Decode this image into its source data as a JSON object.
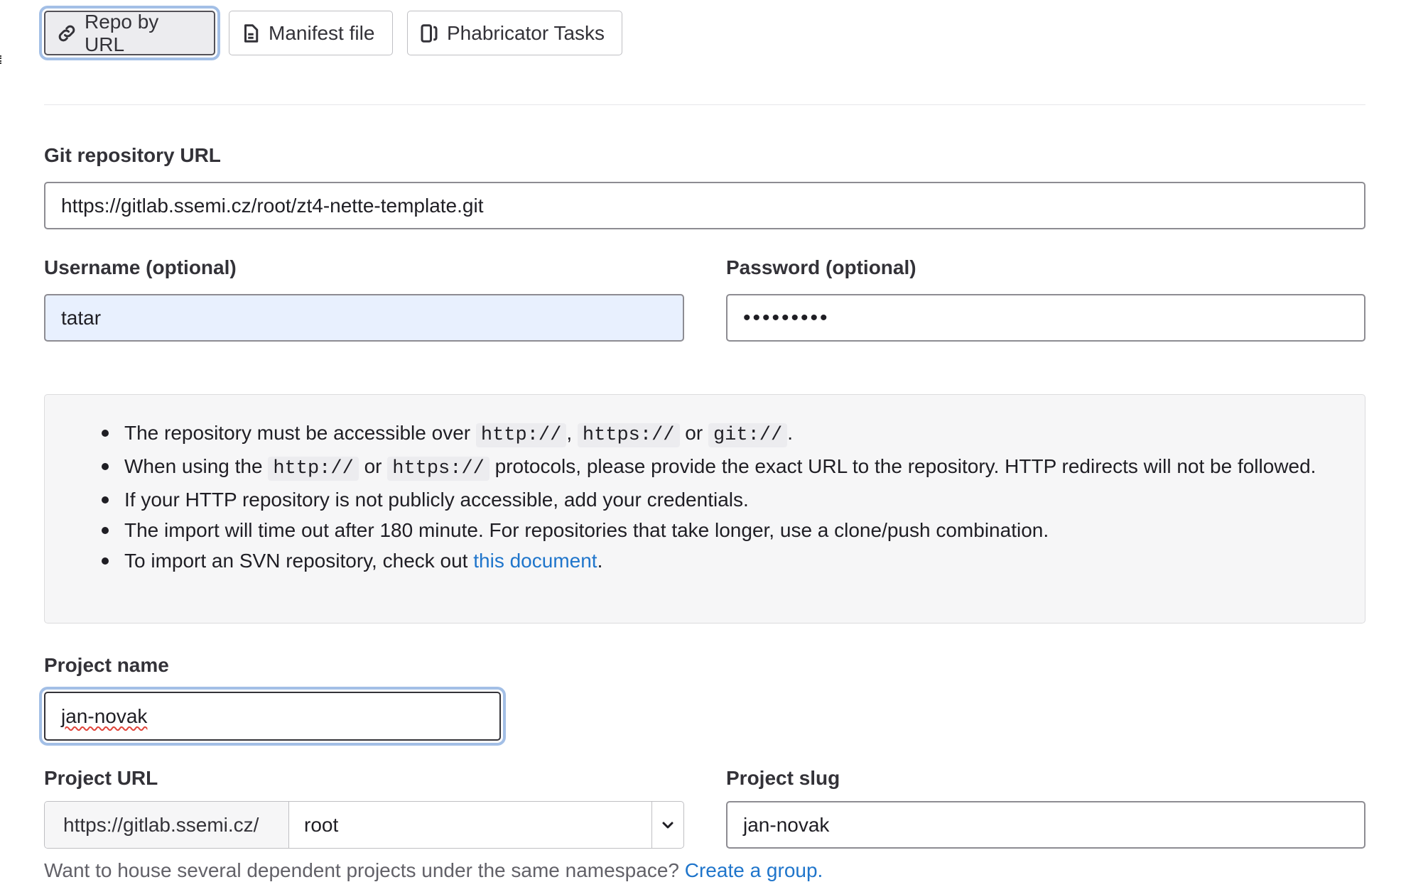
{
  "import_methods": {
    "repo_by_url": {
      "label": "Repo by URL",
      "icon": "link-icon",
      "active": true
    },
    "manifest_file": {
      "label": "Manifest file",
      "icon": "document-icon"
    },
    "phabricator_tasks": {
      "label": "Phabricator Tasks",
      "icon": "tasks-icon"
    }
  },
  "git_repo": {
    "label": "Git repository URL",
    "value": "https://gitlab.ssemi.cz/root/zt4-nette-template.git"
  },
  "username": {
    "label": "Username (optional)",
    "value": "tatar"
  },
  "password": {
    "label": "Password (optional)",
    "masked_value": "•••••••••"
  },
  "info": {
    "item1_text": "The repository must be accessible over",
    "item1_code1": "http://",
    "item1_sep": ",",
    "item1_code2": "https://",
    "item1_or": "or",
    "item1_code3": "git://",
    "item1_end": ".",
    "item2_text": "When using the",
    "item2_code1": "http://",
    "item2_or": "or",
    "item2_code2": "https://",
    "item2_rest": "protocols, please provide the exact URL to the repository. HTTP redirects will not be followed.",
    "item3": "If your HTTP repository is not publicly accessible, add your credentials.",
    "item4": "The import will time out after 180 minute. For repositories that take longer, use a clone/push combination.",
    "item5_text": "To import an SVN repository, check out",
    "item5_link": "this document",
    "item5_end": "."
  },
  "project_name": {
    "label": "Project name",
    "value": "jan-novak"
  },
  "project_url": {
    "label": "Project URL",
    "prefix": "https://gitlab.ssemi.cz/",
    "namespace": "root"
  },
  "project_slug": {
    "label": "Project slug",
    "value": "jan-novak"
  },
  "help": {
    "text": "Want to house several dependent projects under the same namespace?",
    "link": "Create a group."
  }
}
